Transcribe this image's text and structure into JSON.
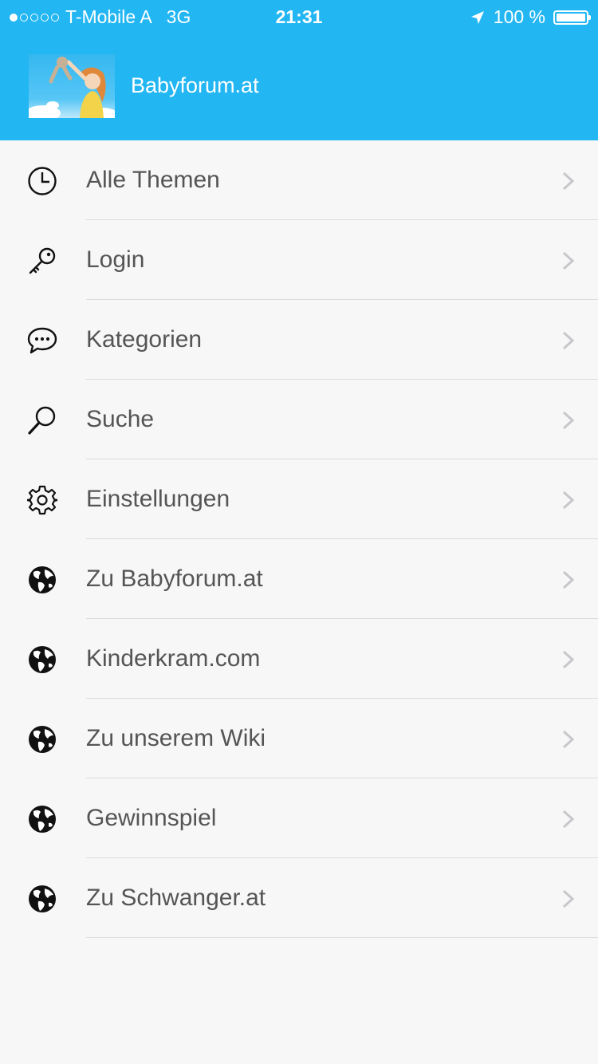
{
  "status_bar": {
    "carrier": "T-Mobile A",
    "network": "3G",
    "time": "21:31",
    "battery": "100 %"
  },
  "header": {
    "title": "Babyforum.at",
    "accent_color": "#22b6f3"
  },
  "menu": {
    "items": [
      {
        "label": "Alle Themen",
        "icon": "clock-icon"
      },
      {
        "label": "Login",
        "icon": "key-icon"
      },
      {
        "label": "Kategorien",
        "icon": "chat-bubble-icon"
      },
      {
        "label": "Suche",
        "icon": "search-icon"
      },
      {
        "label": "Einstellungen",
        "icon": "gear-icon"
      },
      {
        "label": "Zu Babyforum.at",
        "icon": "globe-icon"
      },
      {
        "label": "Kinderkram.com",
        "icon": "globe-icon"
      },
      {
        "label": "Zu unserem Wiki",
        "icon": "globe-icon"
      },
      {
        "label": "Gewinnspiel",
        "icon": "globe-icon"
      },
      {
        "label": "Zu Schwanger.at",
        "icon": "globe-icon"
      }
    ]
  }
}
